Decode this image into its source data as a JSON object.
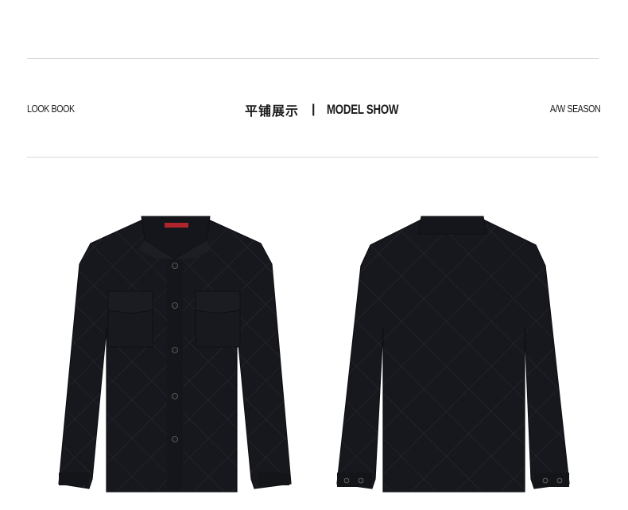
{
  "header": {
    "left_label": "LOOK BOOK",
    "title_cn": "平铺展示",
    "separator": "|",
    "title_en": "MODEL SHOW",
    "right_label": "A/W SEASON"
  },
  "colors": {
    "rule": "#d9d9d9",
    "garment": "#17181d",
    "stitch": "#2a2c33",
    "label_red": "#b0242b"
  },
  "images": [
    {
      "name": "jacket-front",
      "description_hidden": true
    },
    {
      "name": "jacket-back",
      "description_hidden": true
    }
  ]
}
